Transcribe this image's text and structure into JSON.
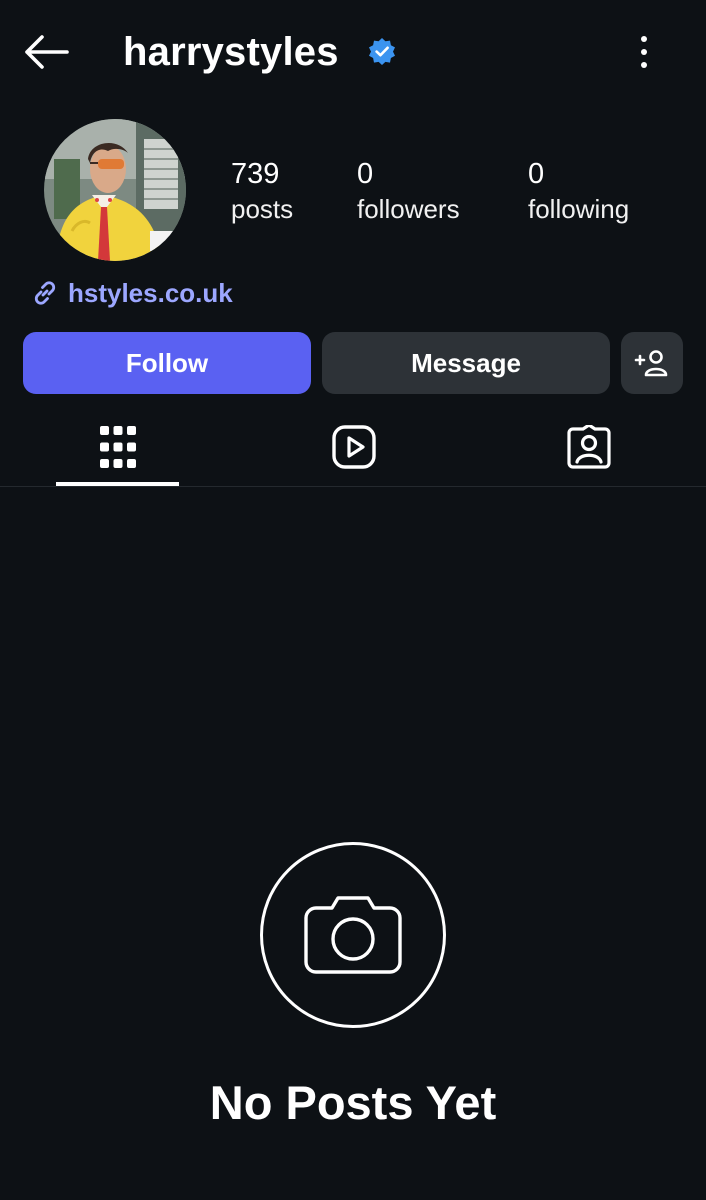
{
  "header": {
    "username": "harrystyles",
    "verified_icon": "verified-badge-icon",
    "back_icon": "arrow-left-icon",
    "more_icon": "more-vertical-icon"
  },
  "profile": {
    "stats": {
      "posts": {
        "value": "739",
        "label": "posts"
      },
      "followers": {
        "value": "0",
        "label": "followers"
      },
      "following": {
        "value": "0",
        "label": "following"
      }
    },
    "link": {
      "icon": "link-icon",
      "text": "hstyles.co.uk"
    }
  },
  "actions": {
    "follow_label": "Follow",
    "message_label": "Message",
    "add_user_icon": "add-user-icon"
  },
  "tabs": [
    {
      "icon": "grid-icon",
      "active": true
    },
    {
      "icon": "reels-icon",
      "active": false
    },
    {
      "icon": "tagged-icon",
      "active": false
    }
  ],
  "empty_state": {
    "icon": "camera-icon",
    "title": "No Posts Yet"
  },
  "colors": {
    "background": "#0d1115",
    "follow_button": "#5a61f2",
    "secondary_button": "#2d3237",
    "link": "#9ca7ff",
    "verified": "#3b94f0"
  }
}
